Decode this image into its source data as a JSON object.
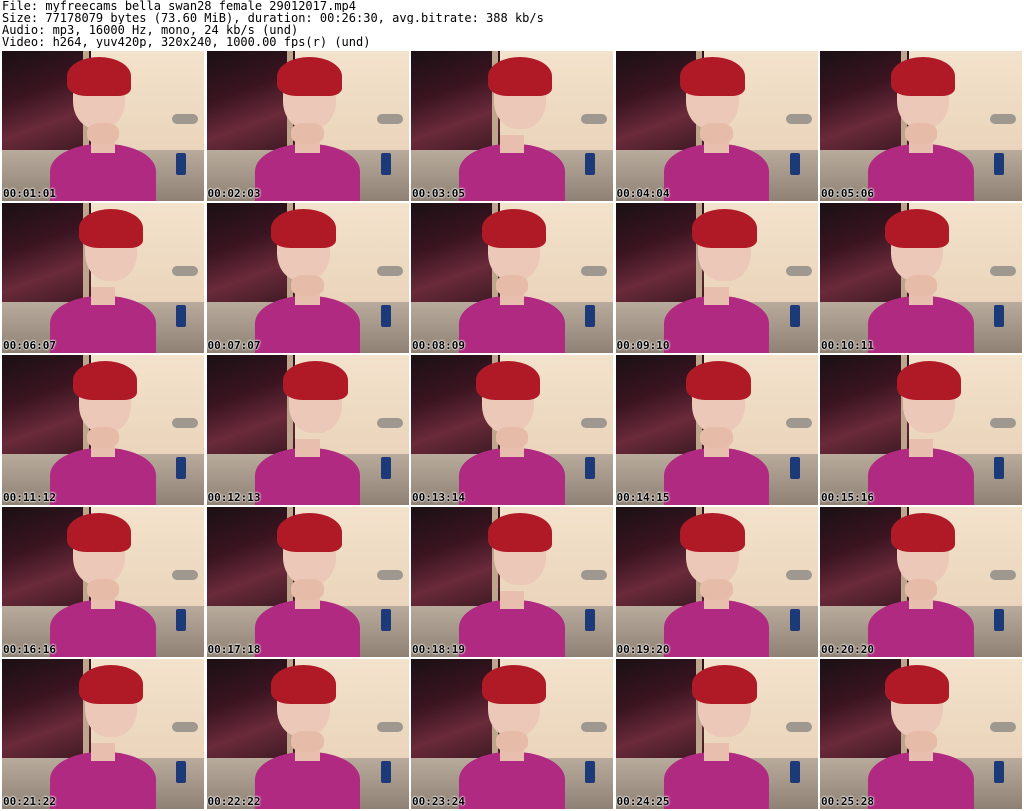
{
  "header": {
    "file": "File: myfreecams_bella_swan28_female_29012017.mp4",
    "size": "Size: 77178079 bytes (73.60 MiB), duration: 00:26:30, avg.bitrate: 388 kb/s",
    "audio": "Audio: mp3, 16000 Hz, mono, 24 kb/s (und)",
    "video": "Video: h264, yuv420p, 320x240, 1000.00 fps(r) (und)"
  },
  "timestamps": [
    "00:01:01",
    "00:02:03",
    "00:03:05",
    "00:04:04",
    "00:05:06",
    "00:06:07",
    "00:07:07",
    "00:08:09",
    "00:09:10",
    "00:10:11",
    "00:11:12",
    "00:12:13",
    "00:13:14",
    "00:14:15",
    "00:15:16",
    "00:16:16",
    "00:17:18",
    "00:18:19",
    "00:19:20",
    "00:20:20",
    "00:21:22",
    "00:22:22",
    "00:23:24",
    "00:24:25",
    "00:25:28"
  ],
  "colors": {
    "shirt": "#b02a82",
    "hair": "#b01a26",
    "wall": "#f3e2cc"
  }
}
